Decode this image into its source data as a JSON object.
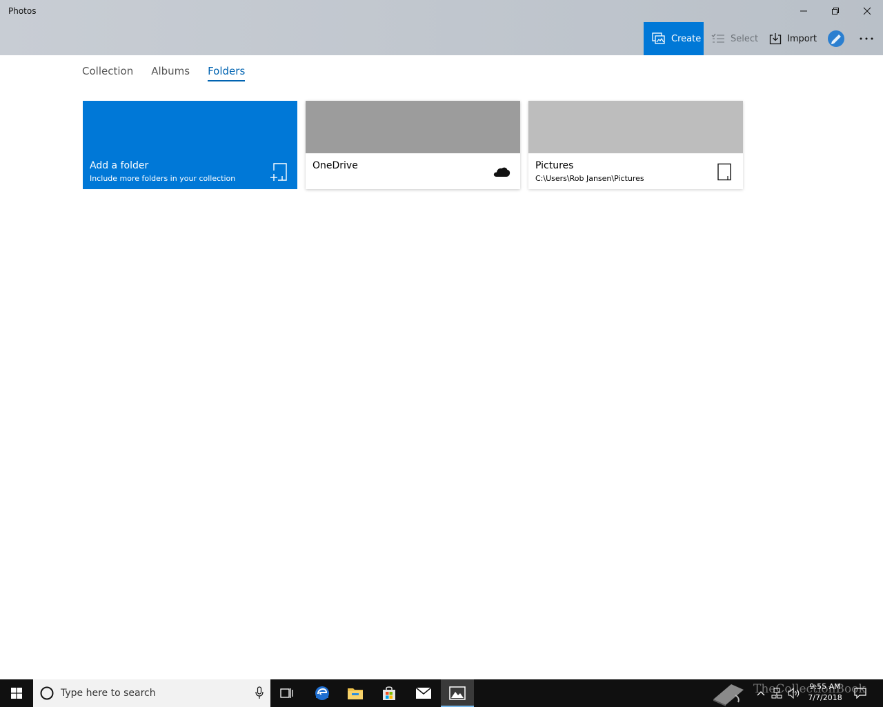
{
  "window": {
    "title": "Photos",
    "minimize_icon": "minimize-icon",
    "maximize_icon": "restore-icon",
    "close_icon": "close-icon"
  },
  "commands": {
    "create_label": "Create",
    "select_label": "Select",
    "import_label": "Import",
    "accent": "#0078d7"
  },
  "tabs": [
    {
      "label": "Collection",
      "active": false
    },
    {
      "label": "Albums",
      "active": false
    },
    {
      "label": "Folders",
      "active": true
    }
  ],
  "tiles": {
    "add": {
      "title": "Add a folder",
      "subtitle": "Include more folders in your collection",
      "icon": "add-folder-icon"
    },
    "onedrive": {
      "title": "OneDrive",
      "icon": "cloud-icon"
    },
    "pictures": {
      "title": "Pictures",
      "path": "C:\\Users\\Rob Jansen\\Pictures",
      "icon": "device-icon"
    }
  },
  "taskbar": {
    "search_placeholder": "Type here to search",
    "clock_time": "9:55 AM",
    "clock_date": "7/7/2018",
    "watermark": "TheCollectionBook"
  }
}
